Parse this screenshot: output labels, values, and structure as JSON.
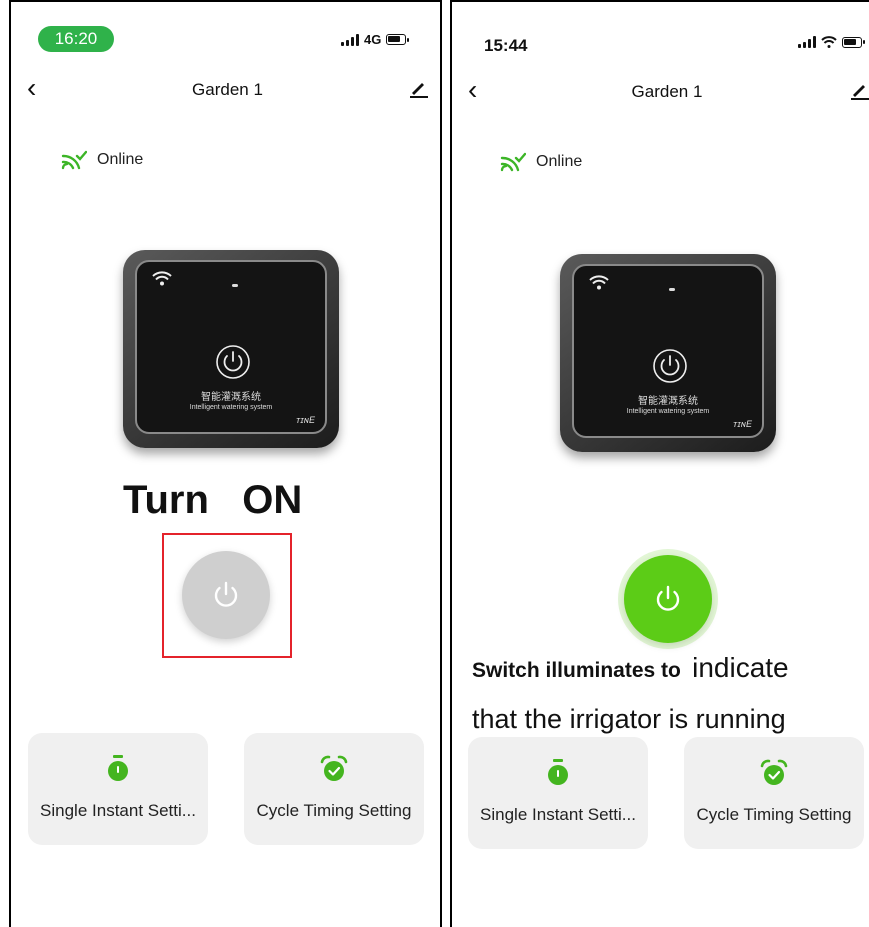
{
  "left": {
    "status_time": "16:20",
    "network": "4G",
    "title": "Garden 1",
    "online_label": "Online",
    "device": {
      "chinese_label": "智能灌溉系统",
      "english_label": "Intelligent watering system",
      "brand": "ᴛɪɴE"
    },
    "annotation": "Turn   ON",
    "card1_label": "Single Instant Setti...",
    "card2_label": "Cycle Timing Setting"
  },
  "right": {
    "status_time": "15:44",
    "title": "Garden 1",
    "online_label": "Online",
    "device": {
      "chinese_label": "智能灌溉系统",
      "english_label": "Intelligent watering system",
      "brand": "ᴛɪɴE"
    },
    "annotation_line1_part1": "Switch illuminates to",
    "annotation_line1_part2": "indicate",
    "annotation_line2": "that the irrigator is running",
    "card1_label": "Single Instant Setti...",
    "card2_label": "Cycle Timing Setting"
  },
  "colors": {
    "accent_green": "#5ccc17",
    "status_pill_green": "#2fb24a",
    "highlight_red": "#e4232b",
    "card_bg": "#f0f0f0"
  },
  "icons": [
    "back-icon",
    "edit-icon",
    "online-signal-icon",
    "power-icon",
    "stopwatch-icon",
    "alarm-clock-icon",
    "wifi-icon",
    "battery-icon",
    "cellular-signal-icon"
  ]
}
